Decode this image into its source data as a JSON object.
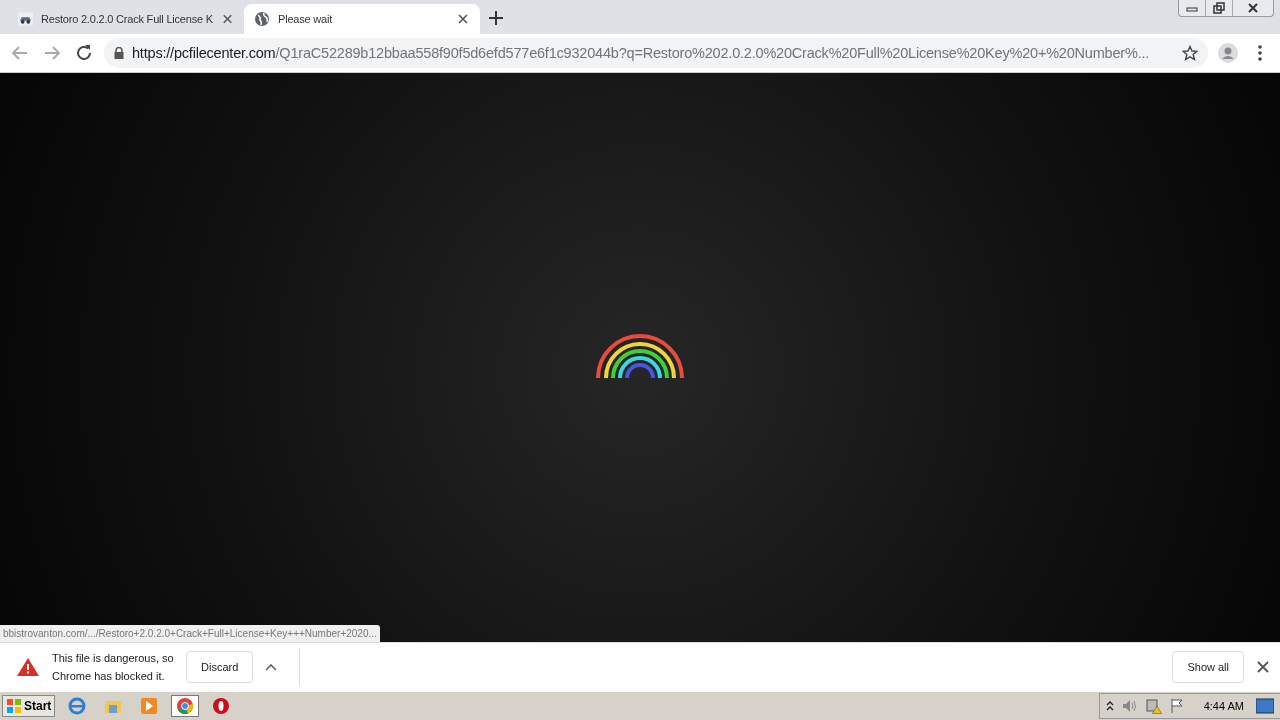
{
  "tabs": [
    {
      "title": "Restoro 2.0.2.0 Crack Full License K",
      "selected": false
    },
    {
      "title": "Please wait",
      "selected": true
    }
  ],
  "address_bar": {
    "host": "https://pcfilecenter.com",
    "path": "/Q1raC52289b12bbaa558f90f5d6efd577e6f1c932044b?q=Restoro%202.0.2.0%20Crack%20Full%20License%20Key%20+%20Number%..."
  },
  "status_url": "bbistrovanton.com/.../Restoro+2.0.2.0+Crack+Full+License+Key+++Number+2020...",
  "download_bar": {
    "message": "This file is dangerous, so Chrome has blocked it.",
    "discard": "Discard",
    "show_all": "Show all"
  },
  "taskbar": {
    "start": "Start",
    "clock": "4:44 AM"
  }
}
